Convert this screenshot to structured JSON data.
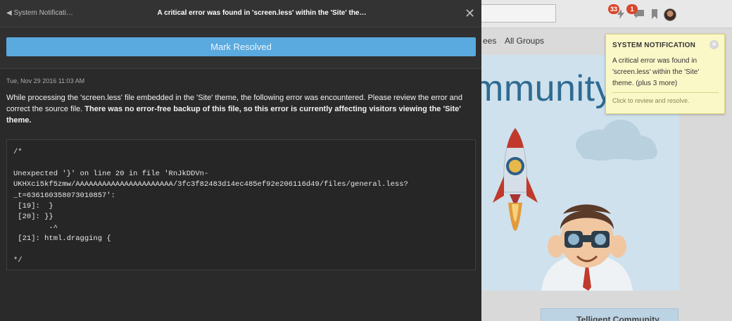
{
  "background": {
    "badges": {
      "notifications": "33",
      "messages": "1"
    },
    "nav": {
      "item_1": "ees",
      "item_2": "All Groups"
    },
    "hero_title": "mmunity",
    "bottom_card_text": "Telligent Community"
  },
  "toast": {
    "title": "SYSTEM NOTIFICATION",
    "body": "A critical error was found in 'screen.less' within the 'Site' theme. (plus 3 more)",
    "footer": "Click to review and resolve."
  },
  "panel": {
    "back_label": "◀ System Notificati…",
    "title": "A critical error was found in 'screen.less' within the 'Site' the…",
    "resolve_label": "Mark Resolved",
    "timestamp": "Tue, Nov 29 2016 11:03 AM",
    "message": "While processing the 'screen.less' file embedded in the 'Site' theme, the following error was encountered. Please review the error and correct the source file. ",
    "message_bold": "There was no error-free backup of this file, so this error is currently affecting visitors viewing the 'Site' theme.",
    "code_lines": [
      "/*",
      "",
      "Unexpected '}' on line 20 in file 'RnJkDDVn-",
      "UKHXci5kf5zmw/AAAAAAAAAAAAAAAAAAAAAA/3fc3f82483d14ec485ef92e206116d49/files/general.less?",
      "_t=636160358073010857':",
      " [19]:  }",
      " [20]: }}",
      "        -^",
      " [21]: html.dragging {",
      "",
      "*/"
    ]
  },
  "colors": {
    "panel_bg": "#2a2a2a",
    "button_blue": "#5aaadf",
    "toast_bg": "#fbf8c8",
    "badge_red": "#d9472b"
  }
}
